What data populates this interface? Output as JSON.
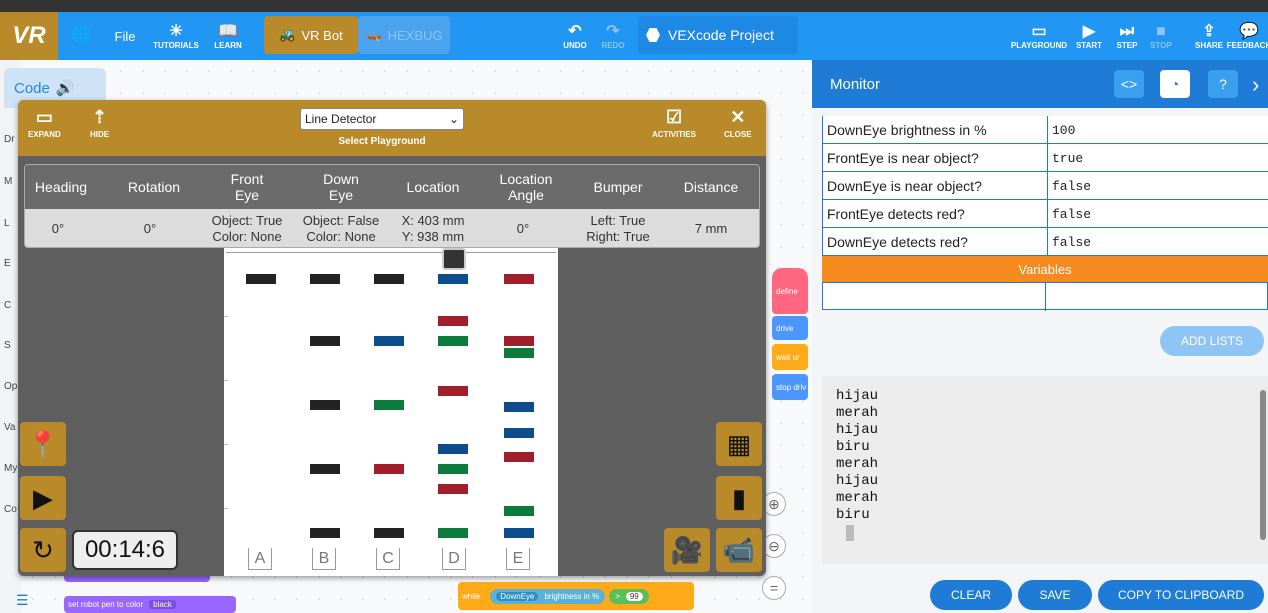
{
  "toolbar": {
    "logo": "VR",
    "file": "File",
    "tutorials": "TUTORIALS",
    "learn": "LEARN",
    "vr_bot": "VR Bot",
    "hexbug": "HEXBUG",
    "undo": "UNDO",
    "redo": "REDO",
    "project_name": "VEXcode Project",
    "playground": "PLAYGROUND",
    "start": "START",
    "step": "STEP",
    "stop": "STOP",
    "share": "SHARE",
    "feedback": "FEEDBACK"
  },
  "code_tab": "Code",
  "categories": [
    "Dr",
    "M",
    "L",
    "E",
    "C",
    "S",
    "Op",
    "Va",
    "My",
    "Co"
  ],
  "blocks": {
    "define": "define",
    "drive": "drive",
    "wait": "wait ur",
    "stop_drive": "stop driv",
    "while": "while",
    "while_sensor": "DownEye",
    "while_prop": "brightness in %",
    "while_op": ">",
    "while_val": "99",
    "pen": "set robot pen to color",
    "pen_color": "black"
  },
  "playground_panel": {
    "expand": "EXPAND",
    "hide": "HIDE",
    "selected": "Line Detector",
    "select_label": "Select Playground",
    "activities": "ACTIVITIES",
    "close": "CLOSE",
    "headers": [
      "Heading",
      "Rotation",
      "Front\nEye",
      "Down\nEye",
      "Location",
      "Location\nAngle",
      "Bumper",
      "Distance"
    ],
    "values": [
      "0°",
      "0°",
      "Object: True\nColor: None",
      "Object: False\nColor: None",
      "X: 403 mm\nY: 938 mm",
      "0°",
      "Left: True\nRight: True",
      "7 mm"
    ],
    "lanes": [
      "A",
      "B",
      "C",
      "D",
      "E"
    ],
    "timer": "00:14:6"
  },
  "colors": {
    "black": "#222222",
    "blue": "#0d4d8c",
    "green": "#0c7a3a",
    "red": "#a11f2a"
  },
  "monitor": {
    "title": "Monitor",
    "rows": [
      {
        "k": "DownEye brightness in %",
        "v": "100"
      },
      {
        "k": "FrontEye is near object?",
        "v": "true"
      },
      {
        "k": "DownEye is near object?",
        "v": "false"
      },
      {
        "k": "FrontEye detects red?",
        "v": "false"
      },
      {
        "k": "DownEye detects red?",
        "v": "false"
      }
    ],
    "variables": "Variables",
    "add_lists": "ADD LISTS",
    "console": "hijau\nmerah\nhijau\nbiru\nmerah\nhijau\nmerah\nbiru",
    "clear": "CLEAR",
    "save": "SAVE",
    "copy": "COPY TO CLIPBOARD"
  }
}
